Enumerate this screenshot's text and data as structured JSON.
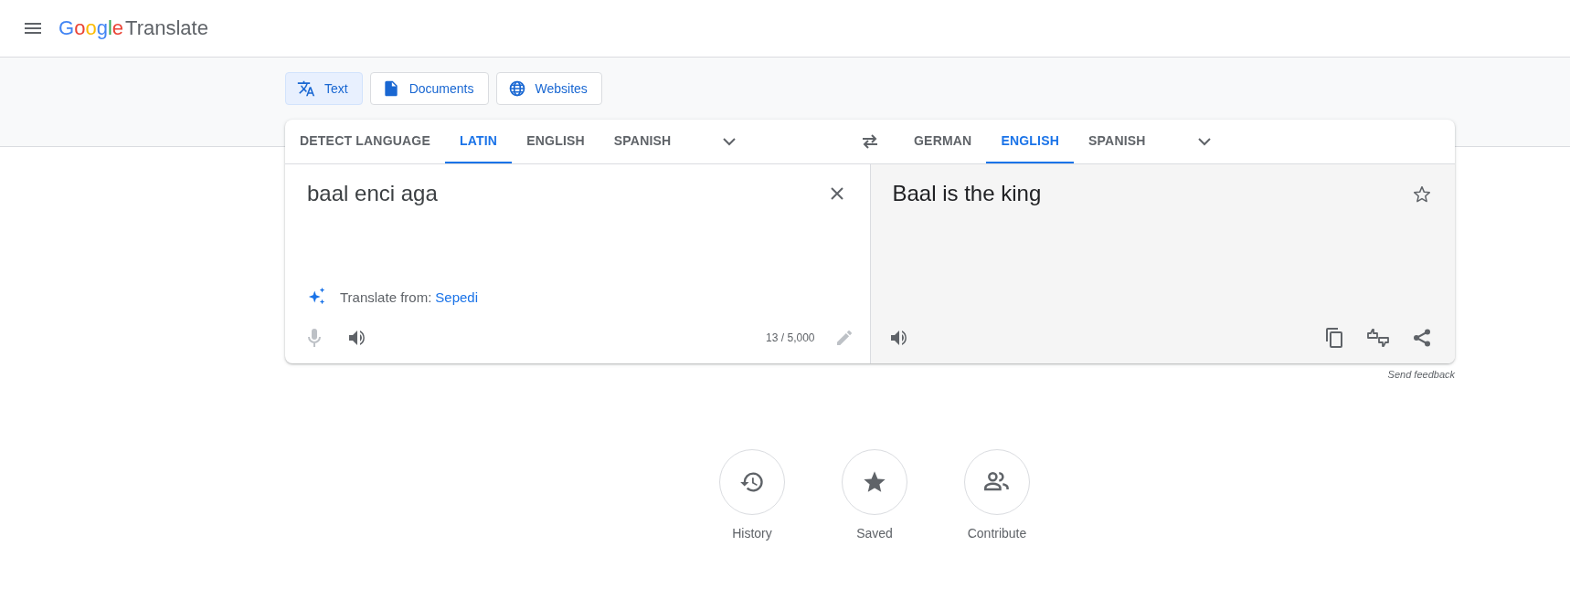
{
  "header": {
    "logo_brand": "Google",
    "logo_product": "Translate"
  },
  "modes": [
    {
      "label": "Text",
      "kind": "translate",
      "selected": true
    },
    {
      "label": "Documents",
      "kind": "document",
      "selected": false
    },
    {
      "label": "Websites",
      "kind": "globe",
      "selected": false
    }
  ],
  "source_languages": [
    {
      "label": "DETECT LANGUAGE",
      "selected": false
    },
    {
      "label": "LATIN",
      "selected": true
    },
    {
      "label": "ENGLISH",
      "selected": false
    },
    {
      "label": "SPANISH",
      "selected": false
    }
  ],
  "target_languages": [
    {
      "label": "GERMAN",
      "selected": false
    },
    {
      "label": "ENGLISH",
      "selected": true
    },
    {
      "label": "SPANISH",
      "selected": false
    }
  ],
  "source": {
    "value": "baal enci aga",
    "suggestion_label": "Translate from:",
    "suggestion_language": "Sepedi",
    "char_count": "13 / 5,000"
  },
  "target": {
    "text": "Baal is the king"
  },
  "send_feedback": "Send feedback",
  "shortcuts": [
    {
      "label": "History",
      "kind": "history"
    },
    {
      "label": "Saved",
      "kind": "star"
    },
    {
      "label": "Contribute",
      "kind": "people"
    }
  ]
}
